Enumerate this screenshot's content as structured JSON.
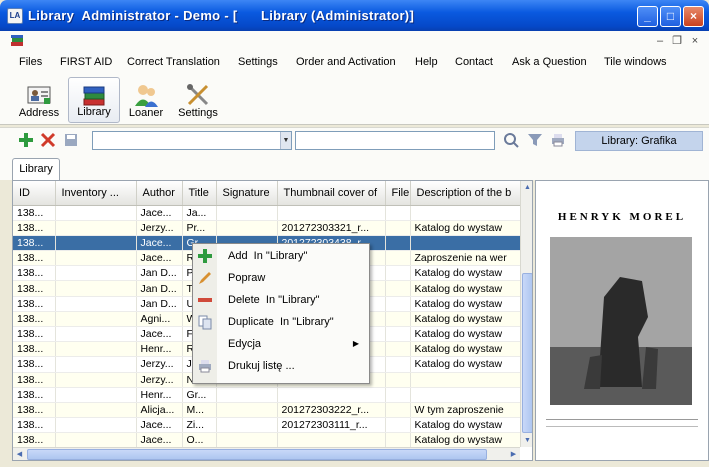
{
  "window": {
    "title": "Library  Administrator - Demo - [      Library (Administrator)]"
  },
  "menu": [
    "Files",
    "FIRST AID",
    "Correct Translation",
    "Settings",
    "Order and Activation",
    "Help",
    "Contact",
    "Ask a Question",
    "Tile windows"
  ],
  "ribbon": {
    "address": "Address",
    "library": "Library",
    "loaner": "Loaner",
    "settings": "Settings"
  },
  "toolbar": {
    "status": "Library: Grafika"
  },
  "tab": {
    "label": "Library"
  },
  "table": {
    "columns": [
      "ID",
      "Inventory ...",
      "Author",
      "Title",
      "Signature",
      "Thumbnail cover of",
      "File",
      "Description of the b"
    ],
    "rows": [
      [
        "138...",
        "",
        "Jace...",
        "Ja...",
        "",
        "",
        "",
        ""
      ],
      [
        "138...",
        "",
        "Jerzy...",
        "Pr...",
        "",
        "201272303321_r...",
        "",
        "Katalog do wystaw"
      ],
      [
        "138...",
        "",
        "Jace...",
        "Gr...",
        "",
        "201272303438_r...",
        "",
        ""
      ],
      [
        "138...",
        "",
        "Jace...",
        "R...",
        "",
        "",
        "",
        "Zaproszenie na wer"
      ],
      [
        "138...",
        "",
        "Jan D...",
        "P...",
        "",
        "",
        "",
        "Katalog do wystaw"
      ],
      [
        "138...",
        "",
        "Jan D...",
        "T...",
        "",
        "",
        "",
        "Katalog do wystaw"
      ],
      [
        "138...",
        "",
        "Jan D...",
        "U...",
        "",
        "",
        "",
        "Katalog do wystaw"
      ],
      [
        "138...",
        "",
        "Agni...",
        "W...",
        "",
        "",
        "",
        "Katalog do wystaw"
      ],
      [
        "138...",
        "",
        "Jace...",
        "F...",
        "",
        "",
        "",
        "Katalog do wystaw"
      ],
      [
        "138...",
        "",
        "Henr...",
        "R...",
        "",
        "",
        "",
        "Katalog do wystaw"
      ],
      [
        "138...",
        "",
        "Jerzy...",
        "J...",
        "",
        "",
        "",
        "Katalog do wystaw"
      ],
      [
        "138...",
        "",
        "Jerzy...",
        "N...",
        "",
        "",
        "",
        ""
      ],
      [
        "138...",
        "",
        "Henr...",
        "Gr...",
        "",
        "",
        "",
        ""
      ],
      [
        "138...",
        "",
        "Alicja...",
        "M...",
        "",
        "201272303222_r...",
        "",
        "W tym zaproszenie"
      ],
      [
        "138...",
        "",
        "Jace...",
        "Zi...",
        "",
        "201272303111_r...",
        "",
        "Katalog do wystaw"
      ],
      [
        "138...",
        "",
        "Jace...",
        "O...",
        "",
        "",
        "",
        "Katalog do wystaw"
      ]
    ]
  },
  "preview": {
    "title": "HENRYK MOREL"
  },
  "context_menu": [
    "Add  In \"Library\"",
    "Popraw",
    "Delete  In \"Library\"",
    "Duplicate  In \"Library\"",
    "Edycja",
    "Drukuj listę ..."
  ],
  "colors": {
    "titlebar": "#0a5ae0",
    "selection": "#3a6ea5",
    "status": "#c4d4ec"
  }
}
